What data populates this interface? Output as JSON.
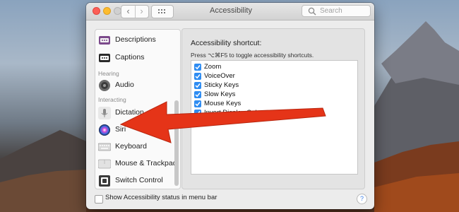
{
  "window": {
    "title": "Accessibility",
    "search_placeholder": "Search",
    "back_glyph": "‹",
    "forward_glyph": "›"
  },
  "sidebar": {
    "items": [
      {
        "label": "Descriptions",
        "icon": "descriptions-icon"
      },
      {
        "label": "Captions",
        "icon": "captions-icon"
      },
      {
        "label": "Audio",
        "icon": "speaker-icon"
      },
      {
        "label": "Dictation",
        "icon": "microphone-icon"
      },
      {
        "label": "Siri",
        "icon": "siri-icon"
      },
      {
        "label": "Keyboard",
        "icon": "keyboard-icon"
      },
      {
        "label": "Mouse & Trackpad",
        "icon": "mouse-icon"
      },
      {
        "label": "Switch Control",
        "icon": "switch-control-icon"
      }
    ],
    "headers": {
      "hearing": "Hearing",
      "interacting": "Interacting"
    }
  },
  "main": {
    "shortcut_title": "Accessibility shortcut:",
    "shortcut_hint": "Press ⌥⌘F5 to toggle accessibility shortcuts.",
    "options": [
      {
        "label": "Zoom",
        "checked": true
      },
      {
        "label": "VoiceOver",
        "checked": true
      },
      {
        "label": "Sticky Keys",
        "checked": true
      },
      {
        "label": "Slow Keys",
        "checked": true
      },
      {
        "label": "Mouse Keys",
        "checked": true
      },
      {
        "label": "Invert Display Color",
        "checked": true
      }
    ]
  },
  "footer": {
    "status_label": "Show Accessibility status in menu bar",
    "help_glyph": "?"
  },
  "colors": {
    "accent": "#2e8cf2",
    "arrow": "#e53418"
  }
}
